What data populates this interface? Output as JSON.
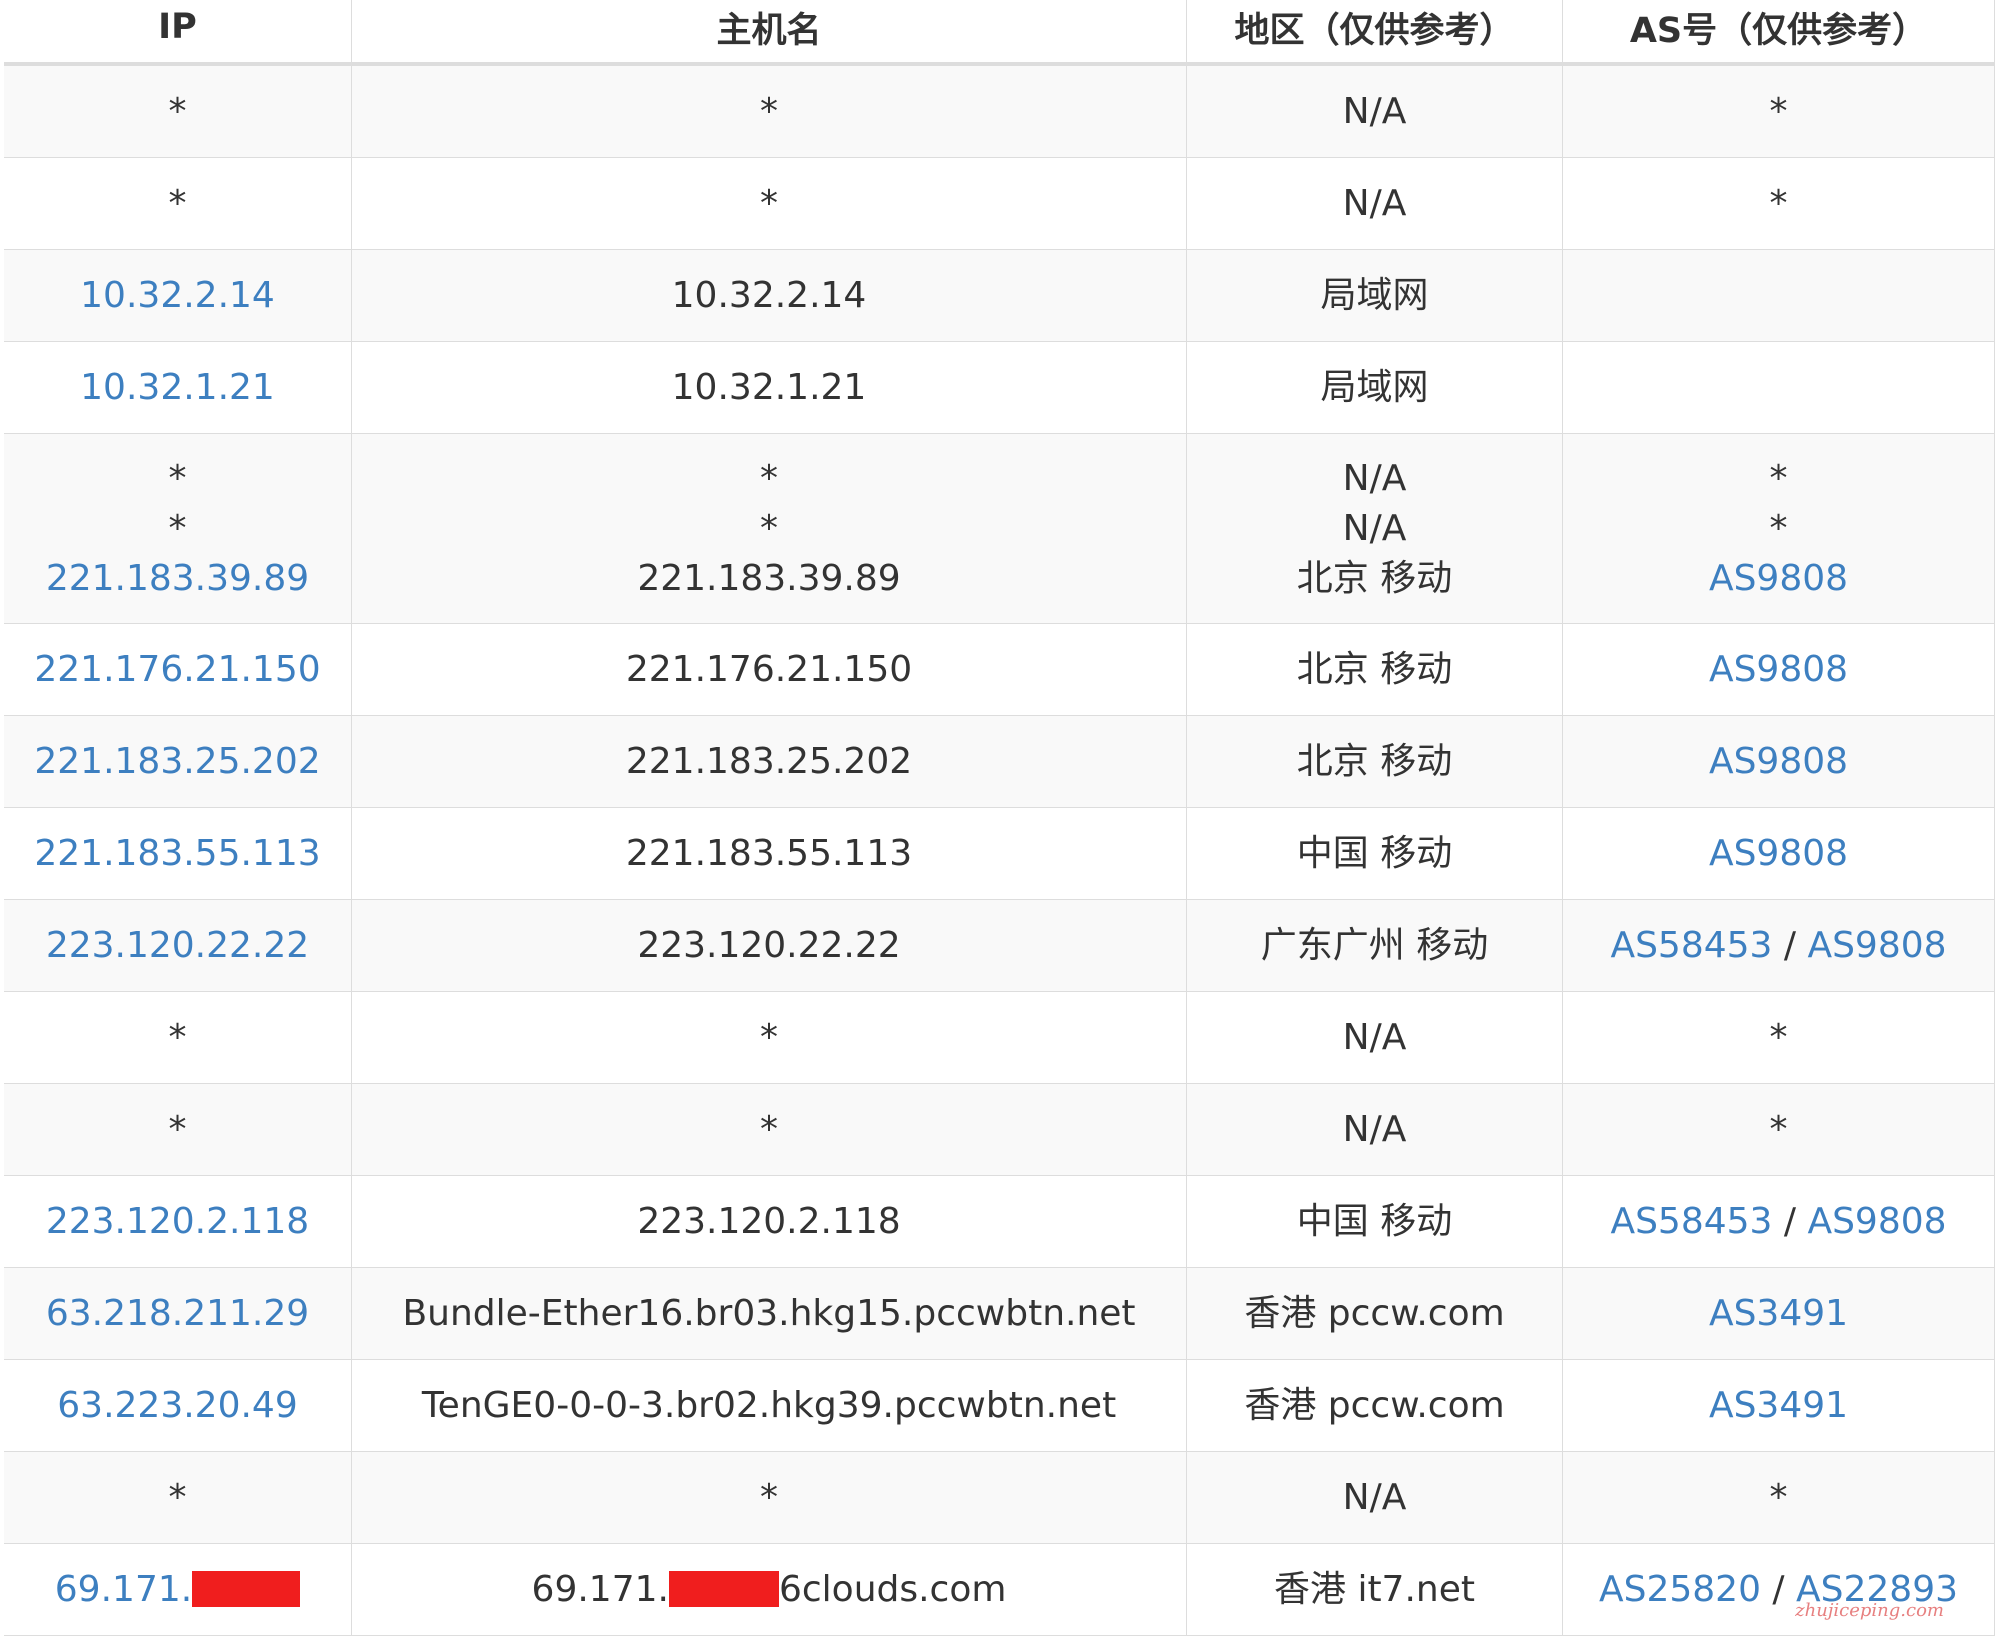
{
  "table": {
    "headers": [
      "IP",
      "主机名",
      "地区（仅供参考）",
      "AS号（仅供参考）"
    ],
    "rows": [
      {
        "ip": [
          "*"
        ],
        "host": [
          "*"
        ],
        "region": [
          "N/A"
        ],
        "as": [
          [
            "*"
          ]
        ]
      },
      {
        "ip": [
          "*"
        ],
        "host": [
          "*"
        ],
        "region": [
          "N/A"
        ],
        "as": [
          [
            "*"
          ]
        ]
      },
      {
        "ip": [
          "10.32.2.14"
        ],
        "host": [
          "10.32.2.14"
        ],
        "region": [
          "局域网"
        ],
        "as": [
          []
        ]
      },
      {
        "ip": [
          "10.32.1.21"
        ],
        "host": [
          "10.32.1.21"
        ],
        "region": [
          "局域网"
        ],
        "as": [
          []
        ]
      },
      {
        "ip": [
          "*",
          "*",
          "221.183.39.89"
        ],
        "host": [
          "*",
          "*",
          "221.183.39.89"
        ],
        "region": [
          "N/A",
          "N/A",
          "北京 移动"
        ],
        "as": [
          [
            "*"
          ],
          [
            "*"
          ],
          [
            "AS9808"
          ]
        ]
      },
      {
        "ip": [
          "221.176.21.150"
        ],
        "host": [
          "221.176.21.150"
        ],
        "region": [
          "北京 移动"
        ],
        "as": [
          [
            "AS9808"
          ]
        ]
      },
      {
        "ip": [
          "221.183.25.202"
        ],
        "host": [
          "221.183.25.202"
        ],
        "region": [
          "北京 移动"
        ],
        "as": [
          [
            "AS9808"
          ]
        ]
      },
      {
        "ip": [
          "221.183.55.113"
        ],
        "host": [
          "221.183.55.113"
        ],
        "region": [
          "中国 移动"
        ],
        "as": [
          [
            "AS9808"
          ]
        ]
      },
      {
        "ip": [
          "223.120.22.22"
        ],
        "host": [
          "223.120.22.22"
        ],
        "region": [
          "广东广州 移动"
        ],
        "as": [
          [
            "AS58453",
            "AS9808"
          ]
        ]
      },
      {
        "ip": [
          "*"
        ],
        "host": [
          "*"
        ],
        "region": [
          "N/A"
        ],
        "as": [
          [
            "*"
          ]
        ]
      },
      {
        "ip": [
          "*"
        ],
        "host": [
          "*"
        ],
        "region": [
          "N/A"
        ],
        "as": [
          [
            "*"
          ]
        ]
      },
      {
        "ip": [
          "223.120.2.118"
        ],
        "host": [
          "223.120.2.118"
        ],
        "region": [
          "中国 移动"
        ],
        "as": [
          [
            "AS58453",
            "AS9808"
          ]
        ]
      },
      {
        "ip": [
          "63.218.211.29"
        ],
        "host": [
          "Bundle-Ether16.br03.hkg15.pccwbtn.net"
        ],
        "region": [
          "香港 pccw.com"
        ],
        "as": [
          [
            "AS3491"
          ]
        ]
      },
      {
        "ip": [
          "63.223.20.49"
        ],
        "host": [
          "TenGE0-0-0-3.br02.hkg39.pccwbtn.net"
        ],
        "region": [
          "香港 pccw.com"
        ],
        "as": [
          [
            "AS3491"
          ]
        ]
      },
      {
        "ip": [
          "*"
        ],
        "host": [
          "*"
        ],
        "region": [
          "N/A"
        ],
        "as": [
          [
            "*"
          ]
        ]
      },
      {
        "ip": [
          "69.171."
        ],
        "host": [
          "69.171.",
          "6clouds.com"
        ],
        "region": [
          "香港 it7.net"
        ],
        "as": [
          [
            "AS25820",
            "AS22893"
          ]
        ],
        "redacted": true
      }
    ]
  },
  "as_separator": " / ",
  "watermark": "zhujiceping.com",
  "colors": {
    "link": "#3d7fc0",
    "text": "#333333",
    "border": "#dddddd",
    "stripe": "#f9f9f9",
    "redaction": "#f01e1e",
    "watermark": "#e36a6a"
  }
}
